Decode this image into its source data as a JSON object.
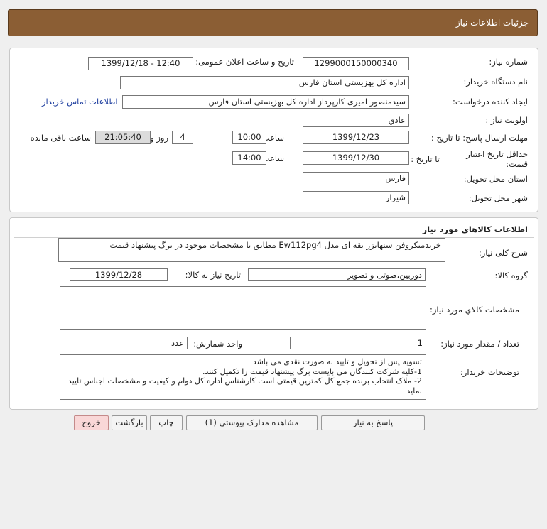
{
  "header": {
    "title": "جزئیات اطلاعات نیاز"
  },
  "info": {
    "need_number_label": "شماره نیاز:",
    "need_number": "1299000150000340",
    "announce_label": "تاریخ و ساعت اعلان عمومی:",
    "announce_value": "1399/12/18 - 12:40",
    "buyer_org_label": "نام دستگاه خریدار:",
    "buyer_org": "اداره کل بهزیستی استان فارس",
    "requester_label": "ایجاد کننده درخواست:",
    "requester": "سیدمنصور امیری کارپرداز اداره کل بهزیستی استان فارس",
    "contact_link": "اطلاعات تماس خریدار",
    "priority_label": "اولویت نیاز :",
    "priority": "عادي",
    "deadline_label": "مهلت ارسال پاسخ: تا تاریخ :",
    "deadline_date": "1399/12/23",
    "time_label": "ساعت",
    "deadline_time": "10:00",
    "days_value": "4",
    "days_label": "روز و",
    "remaining_time": "21:05:40",
    "remaining_label": "ساعت باقی مانده",
    "validity_label": "حداقل تاریخ اعتبار قیمت:",
    "validity_to_label": "تا تاریخ :",
    "validity_date": "1399/12/30",
    "validity_time_label": "ساعت",
    "validity_time": "14:00",
    "province_label": "استان محل تحویل:",
    "province": "فارس",
    "city_label": "شهر محل تحویل:",
    "city": "شیراز"
  },
  "goods": {
    "section_title": "اطلاعات کالاهای مورد نیاز",
    "desc_label": "شرح کلی نیاز:",
    "desc": "خریدمیکروفن سنهایزر یقه ای مدل Ew112pg4 مطابق با مشخصات موجود در برگ پیشنهاد قیمت",
    "group_label": "گروه کالا:",
    "group": "دوربین،صوتی و تصویر",
    "need_date_label": "تاریخ نیاز به کالا:",
    "need_date": "1399/12/28",
    "specs_label": "مشخصات کالاي مورد نياز:",
    "specs": "",
    "qty_label": "تعداد / مقدار مورد نیاز:",
    "qty": "1",
    "unit_label": "واحد شمارش:",
    "unit": "عدد",
    "notes_label": "توضیحات خریدار:",
    "notes_line1": "تسویه پس از تحویل  و تایید به صورت نقدی می باشد",
    "notes_line2": "1-کلیه شرکت کنندگان می بایست برگ پیشنهاد قیمت را تکمیل کنند.",
    "notes_line3": "2- ملاک انتخاب برنده جمع کل کمترین قیمتی است کارشناس اداره کل  دوام و کیفیت و مشخصات اجناس تایید نماید"
  },
  "buttons": {
    "reply": "پاسخ به نیاز",
    "attachments": "مشاهده مدارک پیوستی (1)",
    "print": "چاپ",
    "back": "بازگشت",
    "exit": "خروج"
  }
}
